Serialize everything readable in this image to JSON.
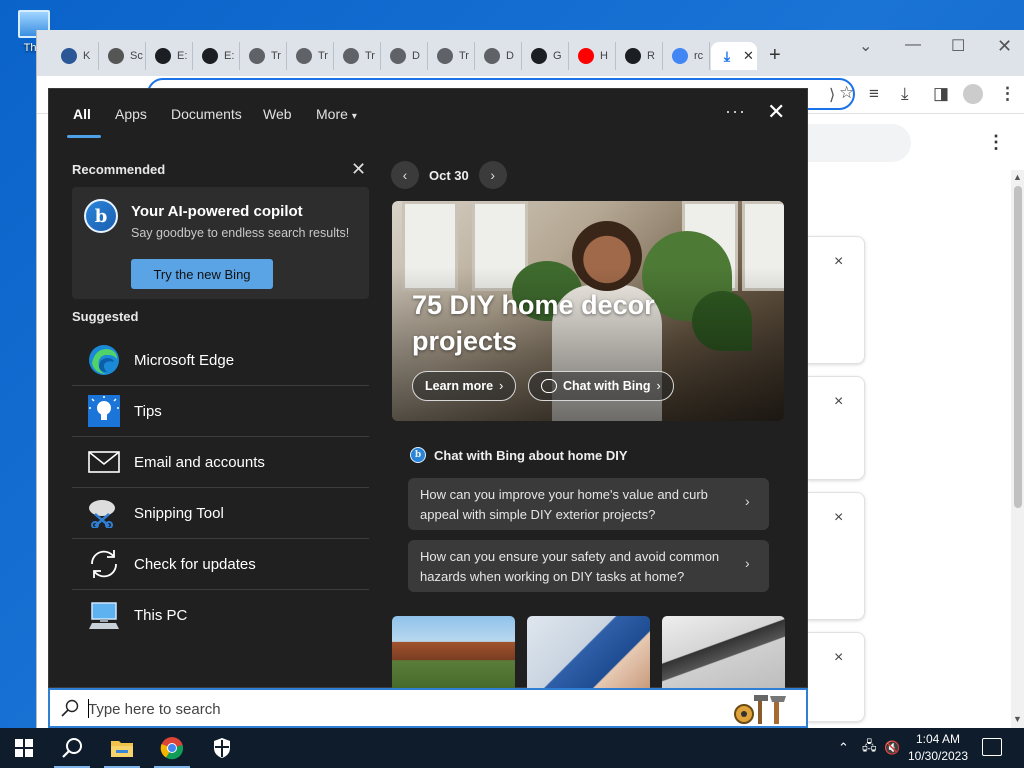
{
  "desktop": {
    "icon_label": "This"
  },
  "browser": {
    "tabs": [
      {
        "letter": "K",
        "color": "#2b5797"
      },
      {
        "letter": "Sc",
        "color": "#555555"
      },
      {
        "letter": "E:",
        "color": "#1b1f23"
      },
      {
        "letter": "E:",
        "color": "#1b1f23"
      },
      {
        "letter": "Tr",
        "color": "#5f6368"
      },
      {
        "letter": "Tr",
        "color": "#5f6368"
      },
      {
        "letter": "Tr",
        "color": "#5f6368"
      },
      {
        "letter": "D",
        "color": "#5f6368"
      },
      {
        "letter": "Tr",
        "color": "#5f6368"
      },
      {
        "letter": "D",
        "color": "#5f6368"
      },
      {
        "letter": "G",
        "color": "#1b1f23"
      },
      {
        "letter": "H",
        "color": "#ff0000"
      },
      {
        "letter": "R",
        "color": "#1b1f23"
      },
      {
        "letter": "rc",
        "color": "#4285f4"
      }
    ],
    "new_tab": "+",
    "page_close_marks": [
      "×",
      "×",
      "×",
      "×"
    ]
  },
  "search_panel": {
    "tabs": [
      "All",
      "Apps",
      "Documents",
      "Web",
      "More"
    ],
    "more_caret": "▾",
    "ellipsis": "···",
    "close": "✕",
    "recommended": {
      "title": "Recommended",
      "close": "✕",
      "card_title": "Your AI-powered copilot",
      "card_subtitle": "Say goodbye to endless search results!",
      "button": "Try the new Bing"
    },
    "suggested": {
      "title": "Suggested",
      "items": [
        {
          "label": "Microsoft Edge",
          "icon": "edge-icon"
        },
        {
          "label": "Tips",
          "icon": "tips-icon"
        },
        {
          "label": "Email and accounts",
          "icon": "mail-icon"
        },
        {
          "label": "Snipping Tool",
          "icon": "snipping-tool-icon"
        },
        {
          "label": "Check for updates",
          "icon": "refresh-icon"
        },
        {
          "label": "This PC",
          "icon": "this-pc-icon"
        }
      ]
    },
    "highlights": {
      "date": "Oct 30",
      "hero_title": "75 DIY home decor projects",
      "learn_more": "Learn more",
      "chat_with_bing": "Chat with Bing",
      "chat_header": "Chat with Bing about home DIY",
      "questions": [
        "How can you improve your home's value and curb appeal with simple DIY exterior projects?",
        "How can you ensure your safety and avoid common hazards when working on DIY tasks at home?"
      ]
    }
  },
  "searchbox": {
    "placeholder": "Type here to search"
  },
  "taskbar": {
    "time": "1:04 AM",
    "date": "10/30/2023"
  }
}
